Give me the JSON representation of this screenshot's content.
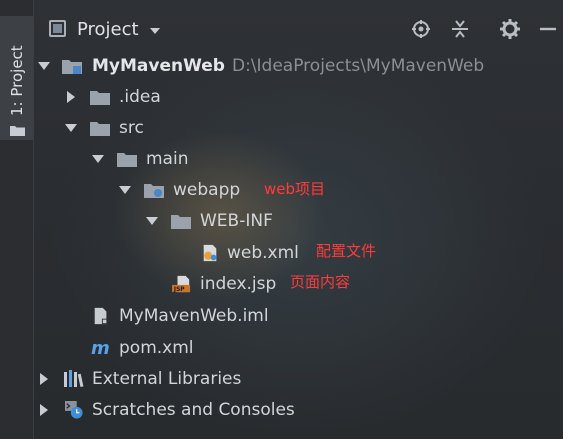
{
  "sidebar": {
    "tab_label": "1: Project",
    "tab_icon": "folder-icon"
  },
  "toolbar": {
    "title": "Project",
    "dropdown_icon": "chevron-down-icon",
    "buttons": [
      "locate-icon",
      "collapse-all-icon",
      "gear-icon",
      "minimize-icon"
    ]
  },
  "tree": {
    "root": {
      "name": "MyMavenWeb",
      "path": "D:\\IdeaProjects\\MyMavenWeb"
    },
    "idea": ".idea",
    "src": "src",
    "main": "main",
    "webapp": "webapp",
    "webinf": "WEB-INF",
    "webxml": "web.xml",
    "indexjsp": "index.jsp",
    "iml": "MyMavenWeb.iml",
    "pom": "pom.xml",
    "external": "External Libraries",
    "scratches": "Scratches and Consoles"
  },
  "annotations": {
    "webapp_note": "web项目",
    "webxml_note": "配置文件",
    "index_note": "页面内容"
  },
  "colors": {
    "annotation": "#ff3b3b",
    "folder": "#9aa3ab",
    "selection_tab": "#3d4044"
  }
}
